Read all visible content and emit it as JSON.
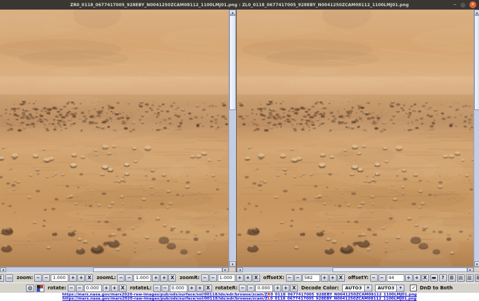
{
  "window": {
    "title": "ZR0_0118_0677417005_928EBY_N0041250ZCAM08112_1100LMJ01.png : ZL0_0118_0677417005_928EBY_N0041250ZCAM08112_1100LMJ01.png",
    "minimize_glyph": "–",
    "close_glyph": "✕"
  },
  "toolbar_zoom": {
    "lead_buttons": [
      {
        "name": "fit-image-button",
        "glyph": "↧"
      },
      {
        "name": "actual-size-button",
        "glyph": "▭"
      }
    ],
    "spinners": [
      {
        "label": "zoom:",
        "value": "1.000"
      },
      {
        "label": "zoomL:",
        "value": "1.000"
      },
      {
        "label": "zoomR:",
        "value": "1.000"
      },
      {
        "label": "offsetX:",
        "value": "582"
      },
      {
        "label": "offsetY:",
        "value": "44"
      }
    ],
    "spinner_buttons": {
      "minus_big": "−",
      "minus": "−",
      "plus": "+",
      "plus_big": "+",
      "clear": "X"
    },
    "trail_buttons": [
      {
        "name": "pan-mode-button",
        "glyph": "▬"
      },
      {
        "name": "help-button",
        "glyph": "?"
      },
      {
        "name": "grid-button",
        "glyph": "⊞"
      },
      {
        "name": "rows-layout-button",
        "glyph": "▤"
      },
      {
        "name": "columns-layout-button",
        "glyph": "▥"
      },
      {
        "name": "tile-layout-button",
        "glyph": "⊞"
      }
    ]
  },
  "toolbar_rotate": {
    "lead_buttons": [
      {
        "name": "settings-button",
        "glyph": "⚙"
      },
      {
        "name": "color-palette-button",
        "glyph": ""
      }
    ],
    "spinners": [
      {
        "label": "rotate:",
        "value": "0.000"
      },
      {
        "label": "rotateL:",
        "value": "0.000"
      },
      {
        "label": "rotateR:",
        "value": "0.000"
      }
    ],
    "decode": {
      "label": "Decode Color:",
      "select1": "AUTO3",
      "select2": "AUTO3",
      "dropdown_glyph": "▼",
      "checkbox_checked": true,
      "check_glyph": "✓",
      "checkbox_label": "DnD to Both"
    }
  },
  "links": [
    {
      "prefix": "https://mars.nasa.gov/mars2020-raw-images/pub/ods/surface/sol/00118/ids/edr/browse/zcam/Z",
      "mark": "R",
      "suffix": "0_0118_0677417005_928EBY_N0041250ZCAM08112_1100LMJ01.png"
    },
    {
      "prefix": "https://mars.nasa.gov/mars2020-raw-images/pub/ods/surface/sol/00118/ids/edr/browse/zcam/Z",
      "mark": "L",
      "suffix": "0_0118_0677417005_928EBY_N0041250ZCAM08112_1100LMJ01.png"
    }
  ],
  "scrollbars": {
    "up": "▲",
    "down": "▼",
    "left": "◄",
    "right": "►"
  },
  "colors": {
    "titlebar_bg": "#3a3732",
    "close_button": "#e0622e",
    "toolbar_bg": "#d6d3cb",
    "scroll_track": "#c3cde3",
    "link_blue": "#1414cc",
    "link_red": "#cc1414",
    "mars_base": "#cf9d6a"
  }
}
